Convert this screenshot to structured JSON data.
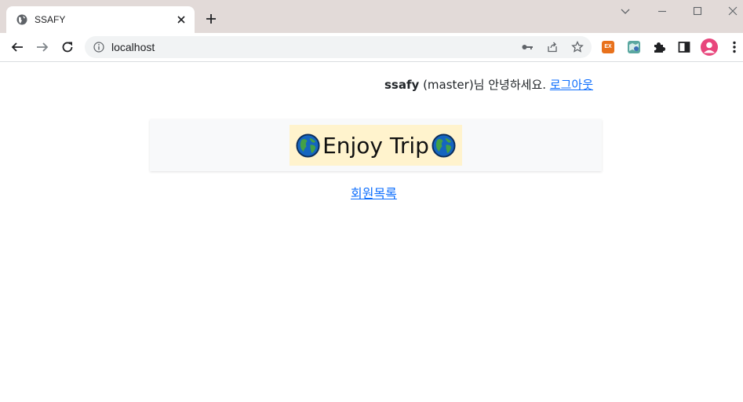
{
  "browser": {
    "tab_title": "SSAFY",
    "url": "localhost",
    "extension_ex_label": "EX"
  },
  "header": {
    "user_id": "ssafy",
    "user_suffix": "(master)님 안녕하세요.",
    "logout_label": "로그아웃"
  },
  "hero": {
    "title": "Enjoy Trip",
    "icon": "globe-emoji"
  },
  "nav": {
    "member_list_label": "회원목록"
  },
  "colors": {
    "link": "#0d6efd",
    "hero_bg": "#f8f9fa",
    "title_bg": "#fff3cd",
    "tabstrip": "#e2dad8"
  }
}
